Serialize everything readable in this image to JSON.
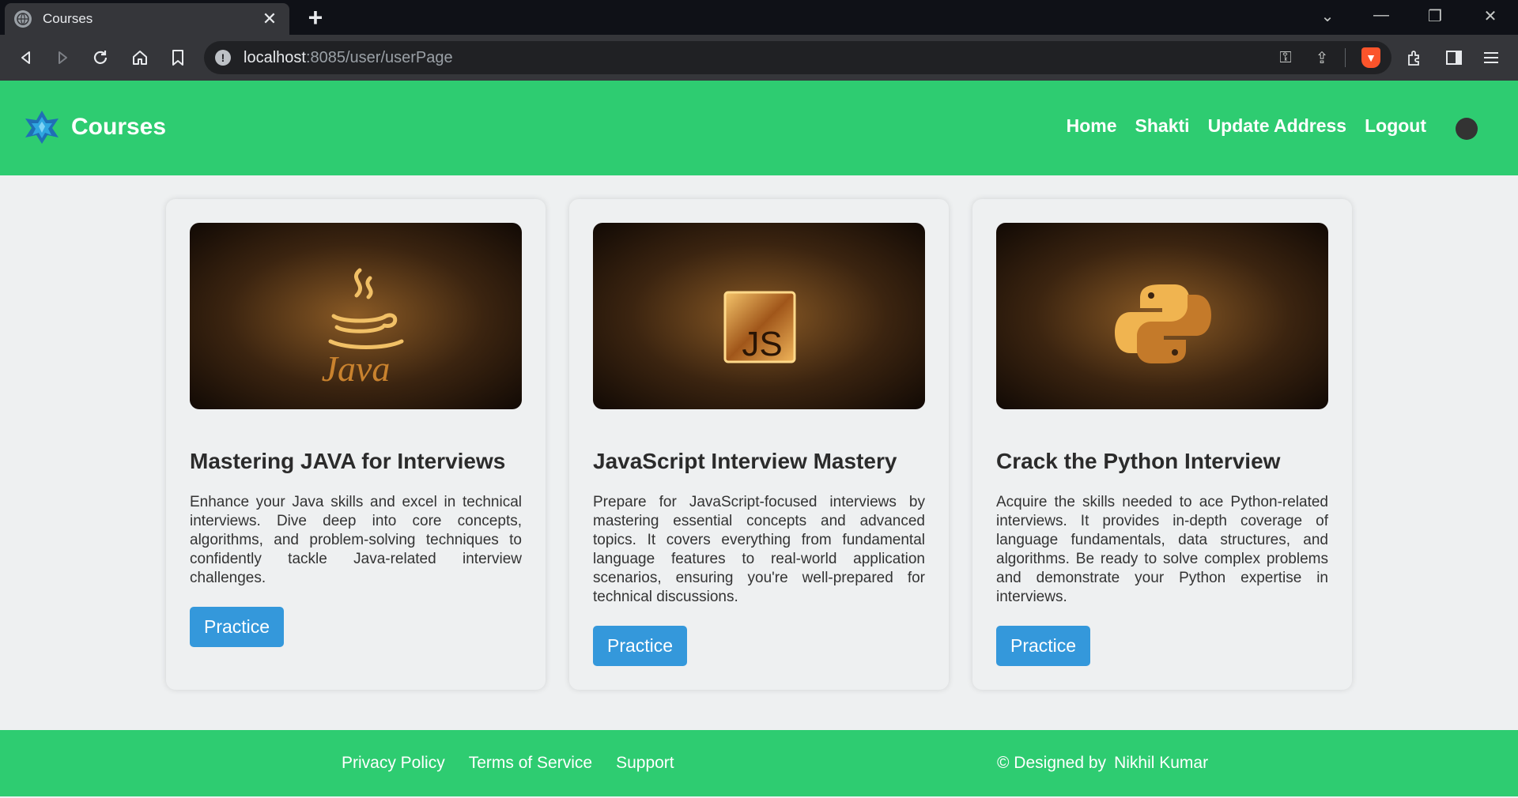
{
  "browser": {
    "tab_title": "Courses",
    "url_host": "localhost",
    "url_path": ":8085/user/userPage"
  },
  "navbar": {
    "brand": "Courses",
    "links": [
      "Home",
      "Shakti",
      "Update Address",
      "Logout"
    ]
  },
  "courses": [
    {
      "image_label": "Java",
      "title": "Mastering JAVA for Interviews",
      "description": "Enhance your Java skills and excel in technical interviews. Dive deep into core concepts, algorithms, and problem-solving techniques to confidently tackle Java-related interview challenges.",
      "button": "Practice"
    },
    {
      "image_label": "JS",
      "title": "JavaScript Interview Mastery",
      "description": "Prepare for JavaScript-focused interviews by mastering essential concepts and advanced topics. It covers everything from fundamental language features to real-world application scenarios, ensuring you're well-prepared for technical discussions.",
      "button": "Practice"
    },
    {
      "image_label": "",
      "title": "Crack the Python Interview",
      "description": "Acquire the skills needed to ace Python-related interviews. It provides in-depth coverage of language fundamentals, data structures, and algorithms. Be ready to solve complex problems and demonstrate your Python expertise in interviews.",
      "button": "Practice"
    }
  ],
  "footer": {
    "links": [
      "Privacy Policy",
      "Terms of Service",
      "Support"
    ],
    "credit_prefix": "© Designed by",
    "credit_name": "Nikhil Kumar"
  },
  "colors": {
    "brand_green": "#2ecc71",
    "button_blue": "#3498db",
    "page_bg": "#eef0f1"
  }
}
